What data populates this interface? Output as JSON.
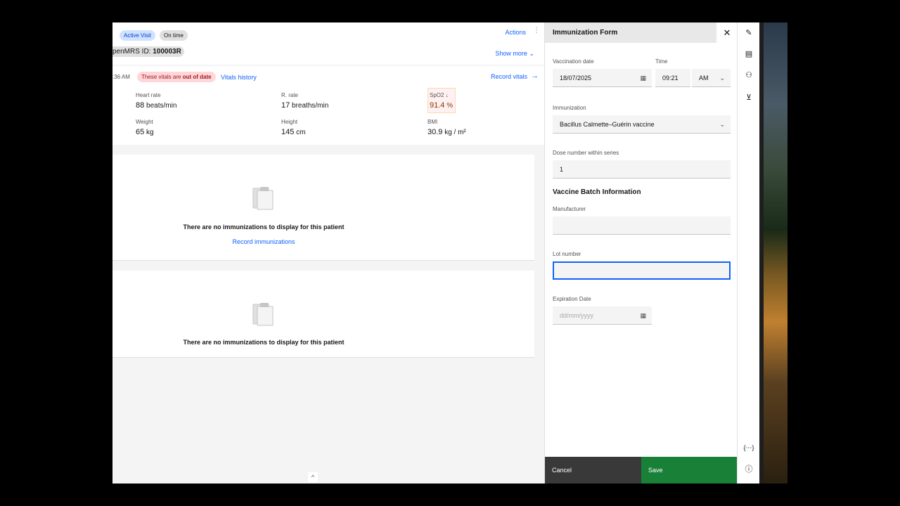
{
  "banner": {
    "active_visit": "Active Visit",
    "on_time": "On time",
    "id_label": "penMRS ID:",
    "id_value": "100003R",
    "actions": "Actions",
    "show_more": "Show more"
  },
  "vitals": {
    "time": ":36 AM",
    "out_of_date_prefix": "These vitals are ",
    "out_of_date_bold": "out of date",
    "history_link": "Vitals history",
    "record_link": "Record vitals",
    "items": [
      {
        "label": "Heart rate",
        "value": "88",
        "unit": "beats/min"
      },
      {
        "label": "R. rate",
        "value": "17",
        "unit": "breaths/min"
      },
      {
        "label": "SpO2 ↓",
        "value": "91.4",
        "unit": "%"
      },
      {
        "label": "Weight",
        "value": "65",
        "unit": "kg"
      },
      {
        "label": "Height",
        "value": "145",
        "unit": "cm"
      },
      {
        "label": "BMI",
        "value": "30.9",
        "unit": "kg / m²"
      }
    ]
  },
  "immunizations": {
    "empty_text": "There are no immunizations to display for this patient",
    "record_link": "Record immunizations"
  },
  "panel": {
    "title": "Immunization Form",
    "vaccination_date_label": "Vaccination date",
    "vaccination_date_value": "18/07/2025",
    "time_label": "Time",
    "time_value": "09:21",
    "ampm_value": "AM",
    "immunization_label": "Immunization",
    "immunization_value": "Bacillus Calmette–Guérin vaccine",
    "dose_label": "Dose number within series",
    "dose_value": "1",
    "batch_title": "Vaccine Batch Information",
    "manufacturer_label": "Manufacturer",
    "manufacturer_value": "",
    "lot_label": "Lot number",
    "lot_value": "",
    "expiration_label": "Expiration Date",
    "expiration_placeholder": "dd/mm/yyyy",
    "cancel": "Cancel",
    "save": "Save"
  },
  "icons": {
    "close": "close-icon",
    "calendar": "calendar-icon",
    "chevron": "chevron-down-icon",
    "pen": "pen-icon",
    "document": "document-icon",
    "people": "people-icon",
    "cart": "cart-icon",
    "code": "code-icon",
    "help": "help-icon"
  },
  "colors": {
    "accent": "#0f62fe",
    "save": "#198038",
    "cancel": "#393939",
    "warning_tag": "#ffd7d9"
  }
}
